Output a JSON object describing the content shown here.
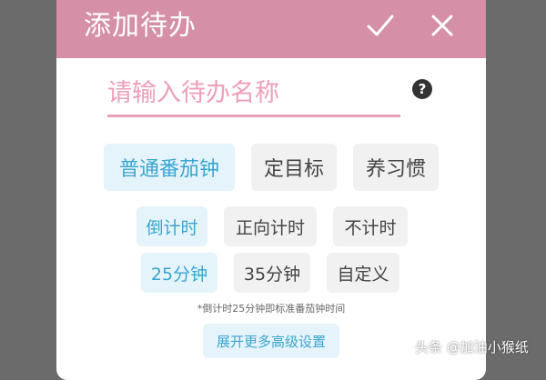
{
  "dialog": {
    "title": "添加待办",
    "confirm_icon": "check-icon",
    "close_icon": "close-icon",
    "header_color": "#d58fa6"
  },
  "name_input": {
    "placeholder": "请输入待办名称",
    "value": "",
    "help_label": "?"
  },
  "type_options": [
    {
      "label": "普通番茄钟",
      "selected": true
    },
    {
      "label": "定目标",
      "selected": false
    },
    {
      "label": "养习惯",
      "selected": false
    }
  ],
  "timer_modes": [
    {
      "label": "倒计时",
      "selected": true
    },
    {
      "label": "正向计时",
      "selected": false
    },
    {
      "label": "不计时",
      "selected": false
    }
  ],
  "durations": [
    {
      "label": "25分钟",
      "selected": true
    },
    {
      "label": "35分钟",
      "selected": false
    },
    {
      "label": "自定义",
      "selected": false
    }
  ],
  "hint": "*倒计时25分钟即标准番茄钟时间",
  "more_settings_label": "展开更多高级设置",
  "watermark": "头条 @加油小猴纸",
  "accent_color": "#3aa6d0"
}
